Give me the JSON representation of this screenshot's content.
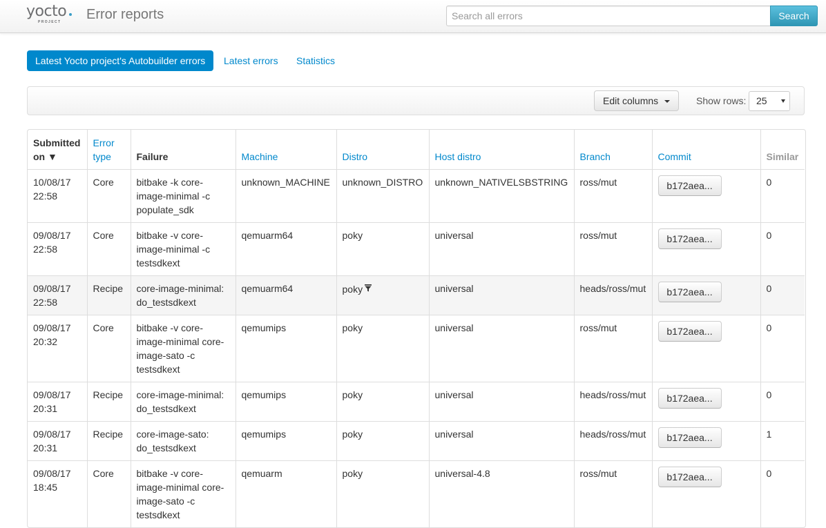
{
  "app": {
    "logo_text": "yocto",
    "logo_subtext": "PROJECT",
    "title": "Error reports",
    "accent": "#0088cc"
  },
  "search": {
    "placeholder": "Search all errors",
    "button_label": "Search"
  },
  "tabs": [
    {
      "label": "Latest Yocto project's Autobuilder errors",
      "active": true
    },
    {
      "label": "Latest errors",
      "active": false
    },
    {
      "label": "Statistics",
      "active": false
    }
  ],
  "toolbar": {
    "edit_columns_label": "Edit columns",
    "show_rows_label": "Show rows:",
    "rows_value": "25"
  },
  "table": {
    "columns": {
      "submitted_on": "Submitted on ▼",
      "error_type": "Error type",
      "failure": "Failure",
      "machine": "Machine",
      "distro": "Distro",
      "host_distro": "Host distro",
      "branch": "Branch",
      "commit": "Commit",
      "similar": "Similar"
    },
    "rows": [
      {
        "submitted": "10/08/17 22:58",
        "type": "Core",
        "failure": "bitbake -k core-image-minimal -c populate_sdk",
        "machine": "unknown_MACHINE",
        "distro": "unknown_DISTRO",
        "host": "unknown_NATIVELSBSTRING",
        "branch": "ross/mut",
        "commit": "b172aea...",
        "similar": "0"
      },
      {
        "submitted": "09/08/17 22:58",
        "type": "Core",
        "failure": "bitbake -v core-image-minimal -c testsdkext",
        "machine": "qemuarm64",
        "distro": "poky",
        "host": "universal",
        "branch": "ross/mut",
        "commit": "b172aea...",
        "similar": "0"
      },
      {
        "submitted": "09/08/17 22:58",
        "type": "Recipe",
        "failure": "core-image-minimal: do_testsdkext",
        "machine": "qemuarm64",
        "distro": "poky",
        "host": "universal",
        "branch": "heads/ross/mut",
        "commit": "b172aea...",
        "similar": "0"
      },
      {
        "submitted": "09/08/17 20:32",
        "type": "Core",
        "failure": "bitbake -v core-image-minimal core-image-sato -c testsdkext",
        "machine": "qemumips",
        "distro": "poky",
        "host": "universal",
        "branch": "ross/mut",
        "commit": "b172aea...",
        "similar": "0"
      },
      {
        "submitted": "09/08/17 20:31",
        "type": "Recipe",
        "failure": "core-image-minimal: do_testsdkext",
        "machine": "qemumips",
        "distro": "poky",
        "host": "universal",
        "branch": "heads/ross/mut",
        "commit": "b172aea...",
        "similar": "0"
      },
      {
        "submitted": "09/08/17 20:31",
        "type": "Recipe",
        "failure": "core-image-sato: do_testsdkext",
        "machine": "qemumips",
        "distro": "poky",
        "host": "universal",
        "branch": "heads/ross/mut",
        "commit": "b172aea...",
        "similar": "1"
      },
      {
        "submitted": "09/08/17 18:45",
        "type": "Core",
        "failure": "bitbake -v core-image-minimal core-image-sato -c testsdkext",
        "machine": "qemuarm",
        "distro": "poky",
        "host": "universal-4.8",
        "branch": "ross/mut",
        "commit": "b172aea...",
        "similar": "0"
      }
    ]
  }
}
